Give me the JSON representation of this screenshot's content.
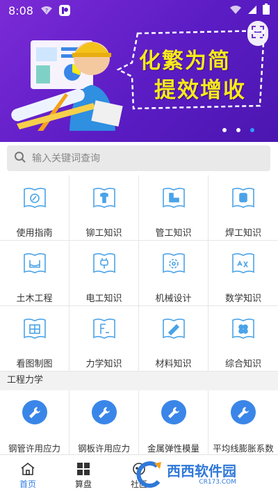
{
  "status_bar": {
    "time": "8:08"
  },
  "banner": {
    "slogan_line1": "化繁为简",
    "slogan_line2": "提效增收"
  },
  "search": {
    "placeholder": "输入关键词查询"
  },
  "categories": [
    {
      "label": "使用指南",
      "icon": "compass-book-icon"
    },
    {
      "label": "铆工知识",
      "icon": "rivet-book-icon"
    },
    {
      "label": "管工知识",
      "icon": "pipe-book-icon"
    },
    {
      "label": "焊工知识",
      "icon": "weld-book-icon"
    },
    {
      "label": "土木工程",
      "icon": "civil-book-icon"
    },
    {
      "label": "电工知识",
      "icon": "plug-book-icon"
    },
    {
      "label": "机械设计",
      "icon": "gear-book-icon"
    },
    {
      "label": "数学知识",
      "icon": "math-book-icon"
    },
    {
      "label": "看图制图",
      "icon": "drawing-book-icon"
    },
    {
      "label": "力学知识",
      "icon": "force-book-icon"
    },
    {
      "label": "材料知识",
      "icon": "material-book-icon"
    },
    {
      "label": "综合知识",
      "icon": "general-book-icon"
    }
  ],
  "section": {
    "title": "工程力学"
  },
  "tools": [
    {
      "label": "钢管许用应力",
      "icon": "wrench-icon"
    },
    {
      "label": "钢板许用应力",
      "icon": "wrench-icon"
    },
    {
      "label": "金属弹性模量",
      "icon": "wrench-icon"
    },
    {
      "label": "平均线膨胀系数",
      "icon": "wrench-icon"
    }
  ],
  "bottom_nav": [
    {
      "label": "首页",
      "icon": "home-icon"
    },
    {
      "label": "算盘",
      "icon": "grid-icon"
    },
    {
      "label": "社区",
      "icon": "community-icon"
    },
    {
      "label": "",
      "icon": ""
    },
    {
      "label": "",
      "icon": ""
    }
  ],
  "watermark": {
    "text": "西西软件园",
    "sub": "CR173.COM"
  },
  "colors": {
    "banner": "#5b1cc4",
    "accent": "#3a86e8",
    "slogan": "#f7ea1a",
    "icon_line": "#4aa3e8"
  }
}
